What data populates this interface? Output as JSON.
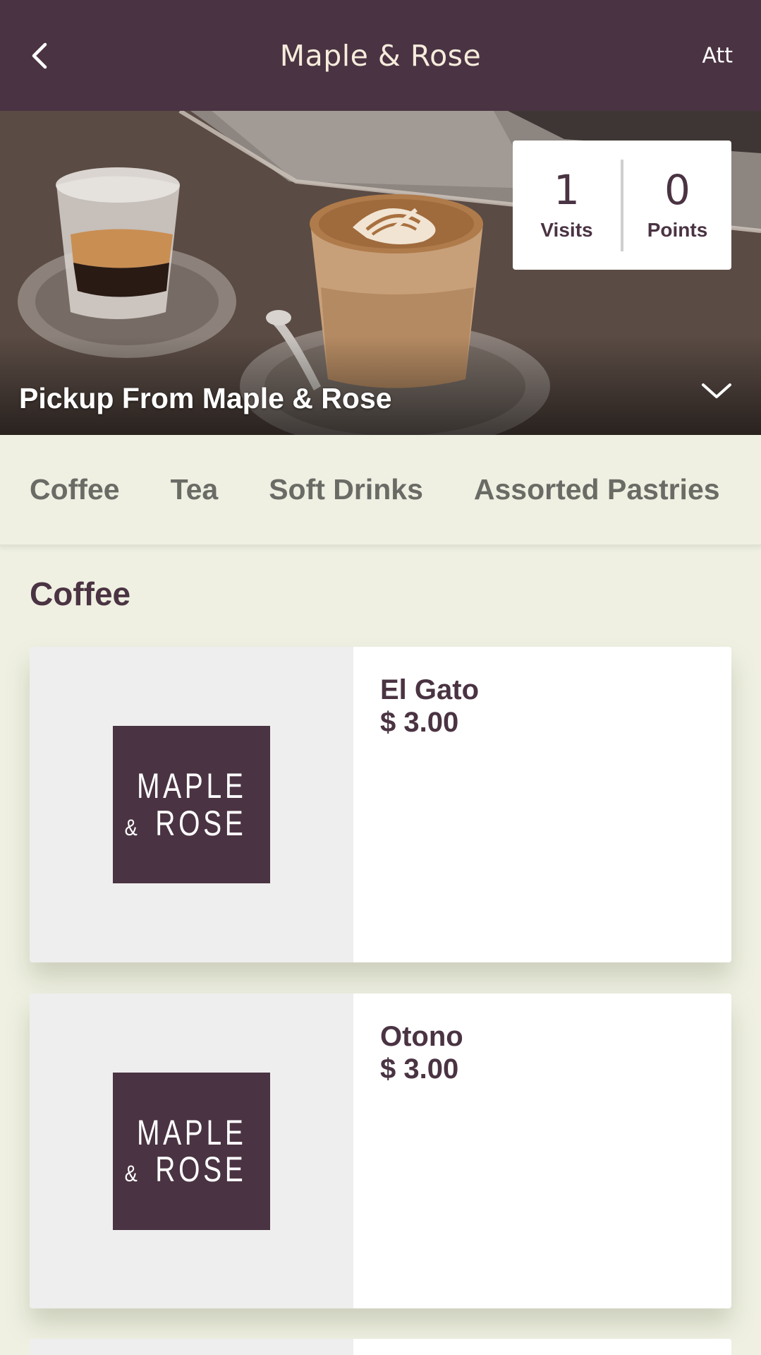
{
  "header": {
    "title": "Maple & Rose",
    "right_text": "Att",
    "back_icon": "chevron-left-icon",
    "background": "#4a3342",
    "title_color": "#f6ecdc"
  },
  "hero": {
    "pickup_title": "Pickup From Maple & Rose",
    "expand_icon": "chevron-down-icon",
    "stats": {
      "visits_value": "1",
      "visits_label": "Visits",
      "points_value": "0",
      "points_label": "Points"
    }
  },
  "tabs": [
    {
      "label": "Coffee"
    },
    {
      "label": "Tea"
    },
    {
      "label": "Soft Drinks"
    },
    {
      "label": "Assorted Pastries"
    }
  ],
  "section": {
    "title": "Coffee"
  },
  "logo": {
    "line1": "MAPLE",
    "amp": "&",
    "line2": "ROSE"
  },
  "items": [
    {
      "name": "El Gato",
      "price": "$ 3.00"
    },
    {
      "name": "Otono",
      "price": "$ 3.00"
    }
  ],
  "colors": {
    "brand": "#4a3342",
    "page_background": "#eff0e2",
    "tab_text": "#6b6b66"
  }
}
